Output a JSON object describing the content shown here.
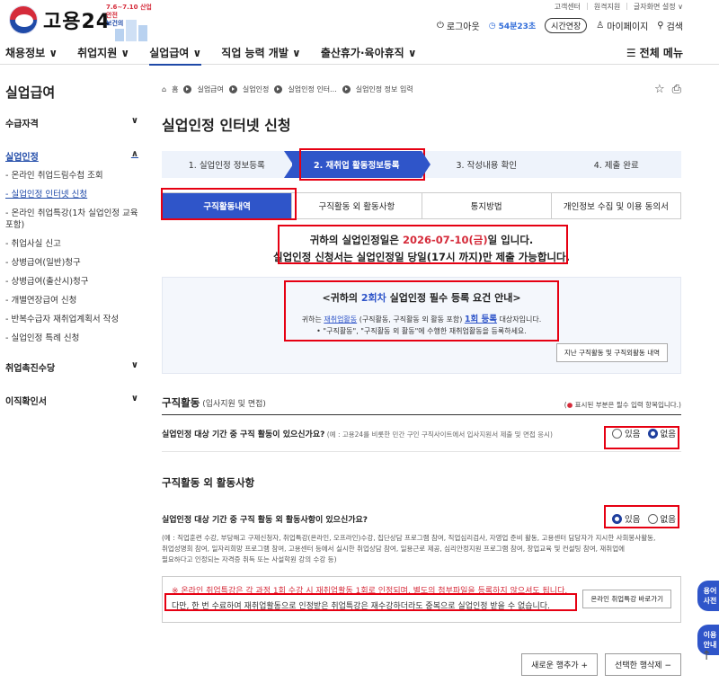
{
  "util": {
    "links": [
      "고객센터",
      "원격지원",
      "글자화면 설정 ∨"
    ]
  },
  "logo": {
    "name": "고용24",
    "badge_line1": "7.6~7.10 산업안전",
    "badge_line2": "보건의 날"
  },
  "header": {
    "logout": "로그아웃",
    "timer": "54분23초",
    "extend": "시간연장",
    "mypage": "마이페이지",
    "search": "검색"
  },
  "gnb": {
    "items": [
      "채용정보 ∨",
      "취업지원 ∨",
      "실업급여 ∨",
      "직업 능력 개발 ∨",
      "출산휴가·육아휴직 ∨"
    ],
    "all_menu": "전체 메뉴"
  },
  "lnb": {
    "title": "실업급여",
    "g1": "수급자격",
    "g2": "실업인정",
    "subs": [
      "- 온라인 취업드림수첩 조회",
      "- 실업인정 인터넷 신청",
      "- 온라인 취업특강(1차 실업인정 교육 포함)",
      "- 취업사실 신고",
      "- 상병급여(일반)청구",
      "- 상병급여(출산시)청구",
      "- 개별연장급여 신청",
      "- 반복수급자 재취업계획서 작성",
      "- 실업인정 특례 신청"
    ],
    "g3": "취업촉진수당",
    "g4": "이직확인서"
  },
  "breadcrumb": [
    "홈",
    "실업급여",
    "실업인정",
    "실업인정 인터...",
    "실업인정 정보 입력"
  ],
  "page_title": "실업인정 인터넷 신청",
  "steps": [
    "1. 실업인정 정보등록",
    "2. 재취업 활동정보등록",
    "3. 작성내용 확인",
    "4. 제출 완료"
  ],
  "tabs": [
    "구직활동내역",
    "구직활동 외 활동사항",
    "통지방법",
    "개인정보 수집 및 이용 동의서"
  ],
  "notice": {
    "pre": "귀하의 실업인정일은 ",
    "date": "2026-07-10(금)",
    "post": "일 입니다.",
    "line2": "실업인정 신청서는 실업인정일 당일(17시 까지)만 제출 가능합니다."
  },
  "guide": {
    "pre": "<귀하의 ",
    "round": "2회차",
    "post": " 실업인정 필수 등록 요건 안내>",
    "l1_pre": "귀하는 ",
    "l1_link": "재취업활동",
    "l1_mid": " (구직활동, 구직활동 외 활동 포함) ",
    "l1_big": "1회 등록",
    "l1_post": " 대상자입니다.",
    "l2": "• \"구직활동\", \"구직활동 외 활동\"에 수행한 재취업활동을 등록하세요.",
    "btn": "지난 구직활동 및 구직외활동 내역"
  },
  "s1": {
    "title": "구직활동",
    "sub": " (입사지원 및 면접)",
    "req_mark": "● ",
    "req": "표시된 부분은 필수 입력 항목입니다.)",
    "req_open": "(",
    "q": "실업인정 대상 기간 중 구직 활동이 있으신가요?",
    "q_hint": " (예 : 고용24를 비롯한 민간 구인 구직사이트에서 입사지원서 제출 및 면접 응시)",
    "yes": "있음",
    "no": "없음"
  },
  "s2": {
    "title": "구직활동 외 활동사항",
    "q": "실업인정 대상 기간 중 구직 활동 외 활동사항이 있으신가요?",
    "yes": "있음",
    "no": "없음",
    "ex1": "(예 : 직업훈련 수강, 부당해고 구제신청자, 취업특강(온라인, 오프라인)수강, 집단상담 프로그램 참여, 직업심리검사, 자영업 준비 활동, 고용센터 담당자가 지시한 사회봉사활동,",
    "ex2": "취업성명회 참여, 일자리희망 프로그램 참여, 고용센터 등에서 실시한 취업상담 참여, 일용근로 제공, 심리안정지원 프로그램 참여, 창업교육 및 컨설팅 참여, 재취업에",
    "ex3": "필요하다고 인정되는 자격증 취득 또는 사설학원 강의 수강 등)"
  },
  "online": {
    "l1": "※ 온라인 취업특강은 각 과정 1회 수강 시 재취업활동 1회로 인정되며, 별도의 첨부파일을 등록하지 않으셔도 됩니다.",
    "l2": "다만, 한 번 수료하여 재취업활동으로 인정받은 취업특강은 재수강하더라도 중복으로 실업인정 받을 수 없습니다.",
    "btn": "온라인 취업특강 바로가기"
  },
  "row_btns": {
    "add": "새로운 행추가 +",
    "del": "선택한 행삭제 −"
  },
  "float": {
    "f1": "용어사전",
    "f2": "이용안내"
  }
}
